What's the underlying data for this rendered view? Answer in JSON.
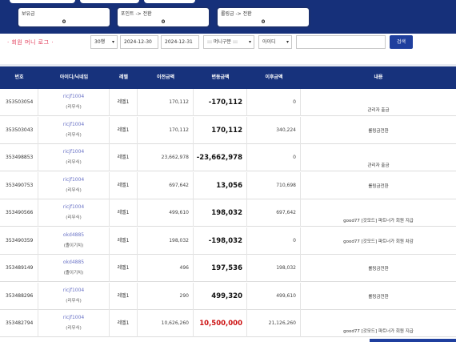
{
  "stats": [
    {
      "label": "보유금",
      "value": "0"
    },
    {
      "label": "포인트 -> 전환",
      "value": "0"
    },
    {
      "label": "롤링금 -> 전환",
      "value": "0"
    }
  ],
  "filters": {
    "title": "· 회원 머니 로그 ·",
    "page_size": "30행",
    "date_from": "2024-12-30",
    "date_to": "2024-12-31",
    "money_type": "::: 머니구분 :::",
    "search_field": "아이디",
    "search_query": "",
    "search_button": "검색"
  },
  "table": {
    "headers": [
      "번호",
      "아이디/닉네임",
      "레벨",
      "이전금액",
      "변동금액",
      "이후금액",
      "내용"
    ],
    "rows": [
      {
        "id": "353503054",
        "user": "ricjf1004",
        "nick": "(리무식)",
        "level": "레벨1",
        "prev": "170,112",
        "change": "-170,112",
        "after": "0",
        "desc": "관리자 출금",
        "desc_pos": "low"
      },
      {
        "id": "353503043",
        "user": "ricjf1004",
        "nick": "(리무식)",
        "level": "레벨1",
        "prev": "170,112",
        "change": "170,112",
        "after": "340,224",
        "desc": "롤링금전환",
        "desc_pos": "mid"
      },
      {
        "id": "353498853",
        "user": "ricjf1004",
        "nick": "(리무식)",
        "level": "레벨1",
        "prev": "23,662,978",
        "change": "-23,662,978",
        "after": "0",
        "desc": "관리자 출금",
        "desc_pos": "low"
      },
      {
        "id": "353490753",
        "user": "ricjf1004",
        "nick": "(리무식)",
        "level": "레벨1",
        "prev": "697,642",
        "change": "13,056",
        "after": "710,698",
        "desc": "롤링금전환",
        "desc_pos": "mid"
      },
      {
        "id": "353490566",
        "user": "ricjf1004",
        "nick": "(리무식)",
        "level": "레벨1",
        "prev": "499,610",
        "change": "198,032",
        "after": "697,642",
        "desc": "good77 [갓모드] 파트너가 회원 지급",
        "desc_pos": "low"
      },
      {
        "id": "353490359",
        "user": "okd4885",
        "nick": "(졸이기치)",
        "level": "레벨1",
        "prev": "198,032",
        "change": "-198,032",
        "after": "0",
        "desc": "good77 [갓모드] 파트너가 회원 차감",
        "desc_pos": "mid"
      },
      {
        "id": "353489149",
        "user": "okd4885",
        "nick": "(졸이기치)",
        "level": "레벨1",
        "prev": "496",
        "change": "197,536",
        "after": "198,032",
        "desc": "롤링금전환",
        "desc_pos": "mid"
      },
      {
        "id": "353488296",
        "user": "ricjf1004",
        "nick": "(리무식)",
        "level": "레벨1",
        "prev": "290",
        "change": "499,320",
        "after": "499,610",
        "desc": "롤링금전환",
        "desc_pos": "mid"
      },
      {
        "id": "353482794",
        "user": "ricjf1004",
        "nick": "(리무식)",
        "level": "레벨1",
        "prev": "10,626,260",
        "change": "10,500,000",
        "after": "21,126,260",
        "desc": "good77 [갓모드] 파트너가 회원 지급",
        "desc_pos": "low",
        "change_color": "#cc1111"
      }
    ]
  }
}
